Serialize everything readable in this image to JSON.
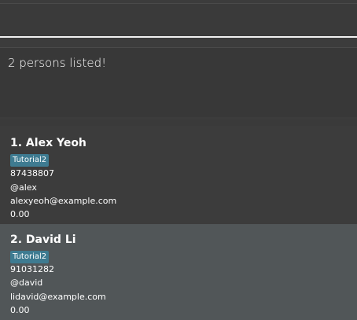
{
  "command_box": {
    "value": "",
    "placeholder": ""
  },
  "result_display": {
    "text": "2 persons listed!"
  },
  "persons": [
    {
      "index_name": "1.  Alex Yeoh",
      "tag": "Tutorial2",
      "phone": "87438807",
      "handle": "@alex",
      "email": "alexyeoh@example.com",
      "score": "0.00"
    },
    {
      "index_name": "2.  David Li",
      "tag": "Tutorial2",
      "phone": "91031282",
      "handle": "@david",
      "email": "lidavid@example.com",
      "score": "0.00"
    }
  ],
  "colors": {
    "background": "#3c3c3c",
    "card_alt": "#515658",
    "tag": "#3e7b91",
    "text": "#ffffff"
  }
}
